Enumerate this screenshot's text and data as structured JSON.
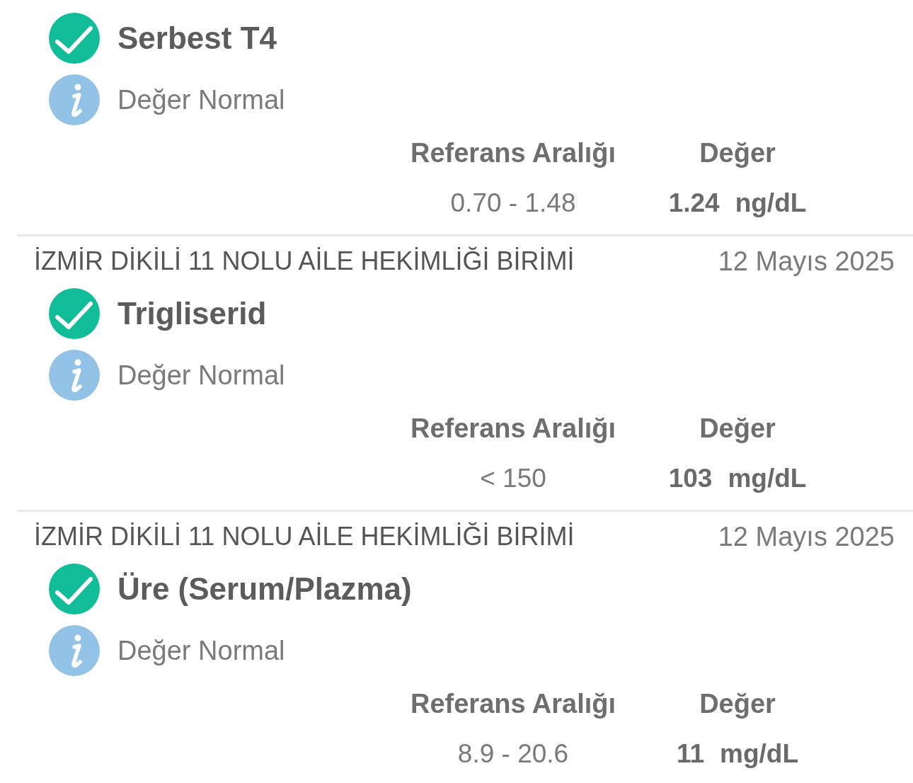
{
  "results": [
    {
      "test": "Serbest T4",
      "normal": true,
      "note": "Değer Normal",
      "range_label": "Referans Aralığı",
      "value_label": "Değer",
      "reference_range": "0.70 - 1.48",
      "value": "1.24",
      "unit": "ng/dL"
    },
    {
      "institution": "İZMİR DİKİLİ 11 NOLU AİLE HEKİMLİĞİ BİRİMİ",
      "date": "12 Mayıs 2025",
      "test": "Trigliserid",
      "normal": true,
      "note": "Değer Normal",
      "range_label": "Referans Aralığı",
      "value_label": "Değer",
      "reference_range": "< 150",
      "value": "103",
      "unit": "mg/dL"
    },
    {
      "institution": "İZMİR DİKİLİ 11 NOLU AİLE HEKİMLİĞİ BİRİMİ",
      "date": "12 Mayıs 2025",
      "test": "Üre (Serum/Plazma)",
      "normal": true,
      "note": "Değer Normal",
      "range_label": "Referans Aralığı",
      "value_label": "Değer",
      "reference_range": "8.9 - 20.6",
      "value": "11",
      "unit": "mg/dL"
    }
  ]
}
